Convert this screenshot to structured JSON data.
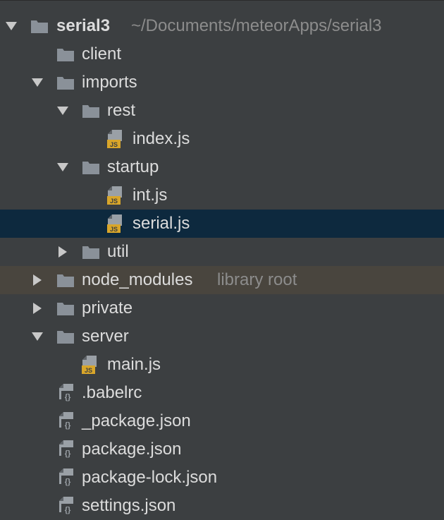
{
  "project": {
    "name": "serial3",
    "path": "~/Documents/meteorApps/serial3"
  },
  "tree": {
    "client": "client",
    "imports": "imports",
    "rest": "rest",
    "index_js": "index.js",
    "startup": "startup",
    "int_js": "int.js",
    "serial_js": "serial.js",
    "util": "util",
    "node_modules": "node_modules",
    "node_modules_hint": "library root",
    "private": "private",
    "server": "server",
    "main_js": "main.js",
    "babelrc": ".babelrc",
    "underscore_package_json": "_package.json",
    "package_json": "package.json",
    "package_lock_json": "package-lock.json",
    "settings_json": "settings.json"
  },
  "colors": {
    "background": "#3c3f41",
    "selected_row": "#0d293e",
    "library_row": "#49453e",
    "folder": "#8a9199",
    "js_badge": "#d9a62a"
  },
  "icons": {
    "expanded": "triangle-down-icon",
    "collapsed": "triangle-right-icon",
    "folder": "folder-icon",
    "js_file": "js-file-icon",
    "json_file": "json-file-icon"
  }
}
